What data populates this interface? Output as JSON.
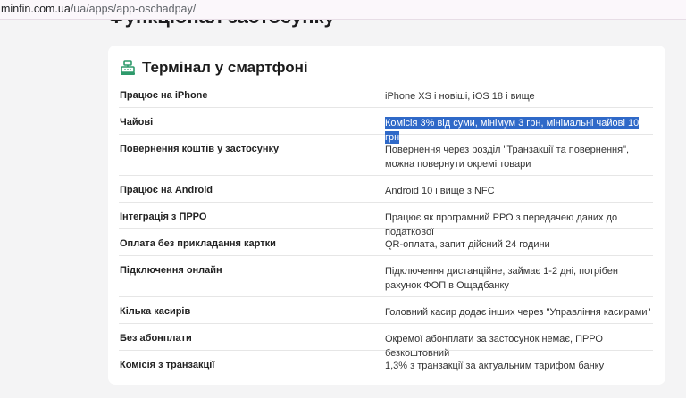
{
  "browser": {
    "url_host": "minfin.com.ua",
    "url_path": "/ua/apps/app-oschadpay/"
  },
  "page": {
    "heading": "Функціонал застосунку"
  },
  "card": {
    "icon": "cash-register-icon",
    "title": "Термінал у смартфоні",
    "rows": [
      {
        "key": "Працює на iPhone",
        "value": "iPhone XS і новіші, iOS 18 і вище"
      },
      {
        "key": "Чайові",
        "value": "Комісія 3% від суми, мінімум 3 грн, мінімальні чайові 10 грн",
        "selected": true
      },
      {
        "key": "Повернення коштів у застосунку",
        "value": "Повернення через розділ \"Транзакції та повернення\", можна повернути окремі товари"
      },
      {
        "key": "Працює на Android",
        "value": "Android 10 і вище з NFC"
      },
      {
        "key": "Інтеграція з ПРРО",
        "value": "Працює як програмний РРО з передачею даних до податкової"
      },
      {
        "key": "Оплата без прикладання картки",
        "value": "QR-оплата, запит дійсний 24 години"
      },
      {
        "key": "Підключення онлайн",
        "value": "Підключення дистанційне, займає 1-2 дні, потрібен рахунок ФОП в Ощадбанку"
      },
      {
        "key": "Кілька касирів",
        "value": "Головний касир додає інших через \"Управління касирами\""
      },
      {
        "key": "Без абонплати",
        "value": "Окремої абонплати за застосунок немає, ПРРО безкоштовний"
      },
      {
        "key": "Комісія з транзакції",
        "value": "1,3% з транзакції за актуальним тарифом банку"
      }
    ]
  },
  "colors": {
    "accent_green": "#2e9a6b",
    "selection": "#2f69c8"
  }
}
